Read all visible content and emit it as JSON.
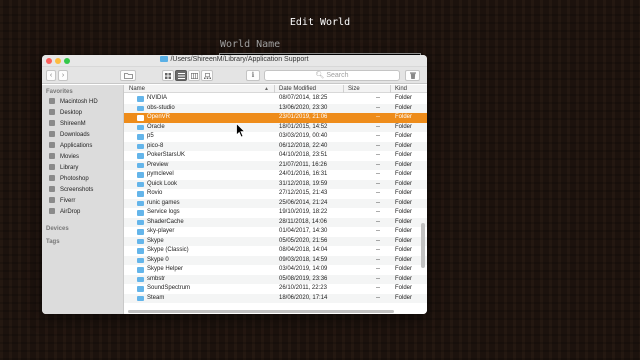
{
  "background_screen": {
    "title": "Edit World",
    "world_name_label": "World Name"
  },
  "finder": {
    "path_title": "/Users/ShireenM/Library/Application Support",
    "toolbar": {
      "back_label": "‹",
      "forward_label": "›",
      "search_placeholder": "Search",
      "info_label": "ℹ",
      "trash_label": "🗑"
    },
    "sidebar": {
      "favorites_heading": "Favorites",
      "favorites": [
        {
          "label": "Macintosh HD",
          "icon": "disk-icon"
        },
        {
          "label": "Desktop",
          "icon": "desktop-icon"
        },
        {
          "label": "ShireenM",
          "icon": "home-icon"
        },
        {
          "label": "Downloads",
          "icon": "downloads-icon"
        },
        {
          "label": "Applications",
          "icon": "applications-icon"
        },
        {
          "label": "Movies",
          "icon": "movies-icon"
        },
        {
          "label": "Library",
          "icon": "folder-icon"
        },
        {
          "label": "Photoshop",
          "icon": "folder-icon"
        },
        {
          "label": "Screenshots",
          "icon": "folder-icon"
        },
        {
          "label": "Fiverr",
          "icon": "folder-icon"
        },
        {
          "label": "AirDrop",
          "icon": "airdrop-icon"
        }
      ],
      "devices_heading": "Devices",
      "tags_heading": "Tags"
    },
    "columns": {
      "name": "Name",
      "date_modified": "Date Modified",
      "size": "Size",
      "kind": "Kind"
    },
    "rows": [
      {
        "name": "NVIDIA",
        "date": "08/07/2014, 18:25",
        "size": "--",
        "kind": "Folder"
      },
      {
        "name": "obs-studio",
        "date": "13/06/2020, 23:30",
        "size": "--",
        "kind": "Folder"
      },
      {
        "name": "OpenVR",
        "date": "23/01/2019, 21:06",
        "size": "--",
        "kind": "Folder",
        "selected": true
      },
      {
        "name": "Oracle",
        "date": "18/01/2015, 14:52",
        "size": "--",
        "kind": "Folder"
      },
      {
        "name": "p5",
        "date": "03/03/2019, 00:40",
        "size": "--",
        "kind": "Folder"
      },
      {
        "name": "pico-8",
        "date": "06/12/2018, 22:40",
        "size": "--",
        "kind": "Folder"
      },
      {
        "name": "PokerStarsUK",
        "date": "04/10/2018, 23:51",
        "size": "--",
        "kind": "Folder"
      },
      {
        "name": "Preview",
        "date": "21/07/2011, 16:26",
        "size": "--",
        "kind": "Folder"
      },
      {
        "name": "pymclevel",
        "date": "24/01/2016, 16:31",
        "size": "--",
        "kind": "Folder"
      },
      {
        "name": "Quick Look",
        "date": "31/12/2018, 19:59",
        "size": "--",
        "kind": "Folder"
      },
      {
        "name": "Rovio",
        "date": "27/12/2015, 21:43",
        "size": "--",
        "kind": "Folder"
      },
      {
        "name": "runic games",
        "date": "25/06/2014, 21:24",
        "size": "--",
        "kind": "Folder"
      },
      {
        "name": "Service logs",
        "date": "19/10/2019, 18:22",
        "size": "--",
        "kind": "Folder"
      },
      {
        "name": "ShaderCache",
        "date": "28/11/2018, 14:06",
        "size": "--",
        "kind": "Folder"
      },
      {
        "name": "sky-player",
        "date": "01/04/2017, 14:30",
        "size": "--",
        "kind": "Folder"
      },
      {
        "name": "Skype",
        "date": "05/05/2020, 21:56",
        "size": "--",
        "kind": "Folder"
      },
      {
        "name": "Skype (Classic)",
        "date": "08/04/2018, 14:04",
        "size": "--",
        "kind": "Folder"
      },
      {
        "name": "Skype 0",
        "date": "09/03/2018, 14:59",
        "size": "--",
        "kind": "Folder"
      },
      {
        "name": "Skype Helper",
        "date": "03/04/2019, 14:09",
        "size": "--",
        "kind": "Folder"
      },
      {
        "name": "smbstr",
        "date": "05/08/2019, 23:36",
        "size": "--",
        "kind": "Folder"
      },
      {
        "name": "SoundSpectrum",
        "date": "26/10/2011, 22:23",
        "size": "--",
        "kind": "Folder"
      },
      {
        "name": "Steam",
        "date": "18/06/2020, 17:14",
        "size": "--",
        "kind": "Folder"
      }
    ]
  },
  "colors": {
    "selection": "#ee8c1a",
    "folder": "#64b5ea",
    "window_bg": "#ffffff",
    "sidebar_bg": "#dcdcdc"
  }
}
